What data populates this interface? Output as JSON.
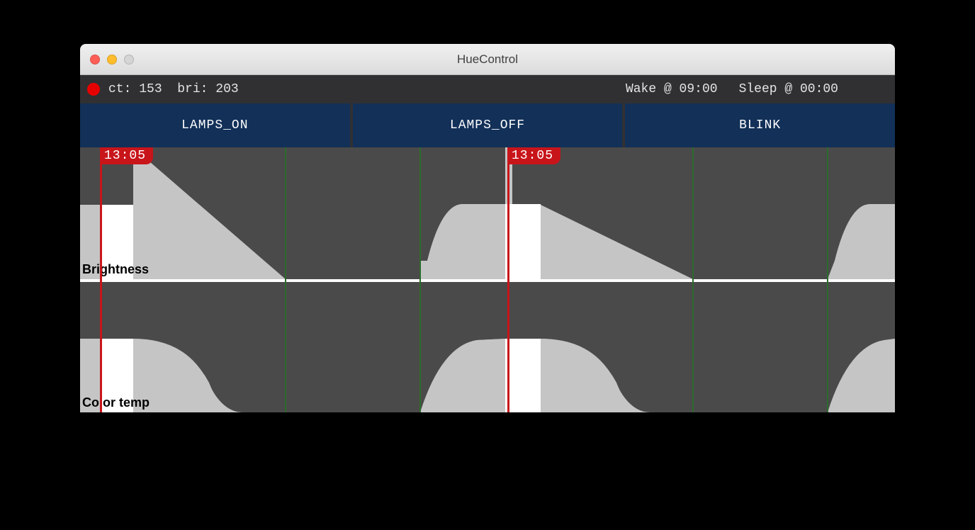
{
  "window": {
    "title": "HueControl"
  },
  "status": {
    "ct_label": "ct:",
    "ct_value": "153",
    "bri_label": "bri:",
    "bri_value": "203",
    "wake_label": "Wake @ 09:00",
    "sleep_label": "Sleep @ 00:00"
  },
  "tabs": [
    {
      "label": "LAMPS_ON"
    },
    {
      "label": "LAMPS_OFF"
    },
    {
      "label": "BLINK"
    }
  ],
  "timeline": {
    "flag_time_1": "13:05",
    "flag_time_2": "13:05",
    "labels": {
      "brightness": "Brightness",
      "color_temp": "Color temp"
    }
  },
  "chart_data": [
    {
      "type": "area",
      "title": "Brightness",
      "xlabel": "",
      "ylabel": "",
      "ylim": [
        0,
        255
      ],
      "x_units": "hours_after_midnight",
      "x": [
        0,
        12.4,
        13.0,
        21.0,
        22.0,
        23.5,
        24.0
      ],
      "values": [
        120,
        120,
        255,
        0,
        0,
        210,
        255
      ],
      "notes": "pattern repeats; current time marker at 13:05; value bri=203"
    },
    {
      "type": "area",
      "title": "Color temp",
      "xlabel": "",
      "ylabel": "",
      "ylim": [
        0,
        500
      ],
      "x_units": "hours_after_midnight",
      "x": [
        0,
        12.4,
        13.0,
        15.0,
        18.0,
        22.5,
        24.0
      ],
      "values": [
        250,
        250,
        500,
        400,
        0,
        0,
        450
      ],
      "notes": "pattern repeats; current time marker at 13:05; value ct=153"
    }
  ]
}
